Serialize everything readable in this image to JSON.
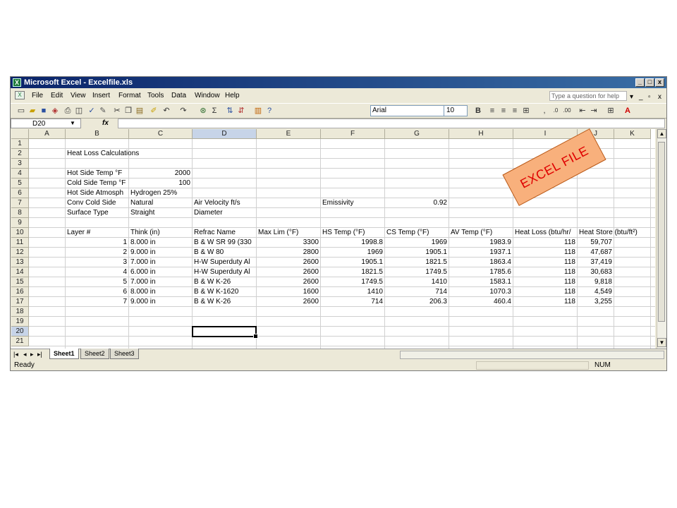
{
  "window": {
    "title": "Microsoft Excel - Excelfile.xls",
    "controls": [
      "_",
      "□",
      "x"
    ]
  },
  "menubar": {
    "items": [
      "File",
      "Edit",
      "View",
      "Insert",
      "Format",
      "Tools",
      "Data",
      "Window",
      "Help"
    ],
    "ask_placeholder": "Type a question for help",
    "doc_controls": [
      "▾",
      "_",
      "▫",
      "x"
    ]
  },
  "toolbar": {
    "font_name": "Arial",
    "font_size": "10",
    "bold_label": "B",
    "icons": [
      "new-icon",
      "open-icon",
      "save-icon",
      "permission-icon",
      "print-icon",
      "print-preview-icon",
      "spelling-icon",
      "research-icon",
      "cut-icon",
      "copy-icon",
      "paste-icon",
      "format-painter-icon",
      "undo-icon",
      "redo-icon",
      "hyperlink-icon",
      "autosum-icon",
      "sort-ascending-icon",
      "sort-descending-icon",
      "chart-wizard-icon",
      "help-icon",
      "align-left-icon",
      "center-icon",
      "align-right-icon",
      "merge-center-icon",
      "comma-style-icon",
      "increase-decimal-icon",
      "decrease-decimal-icon",
      "decrease-indent-icon",
      "increase-indent-icon",
      "borders-icon",
      "font-color-icon"
    ]
  },
  "formula_bar": {
    "name_box": "D20",
    "fx_label": "fx",
    "content": ""
  },
  "grid": {
    "columns": [
      "A",
      "B",
      "C",
      "D",
      "E",
      "F",
      "G",
      "H",
      "I",
      "J",
      "K"
    ],
    "rows": [
      "1",
      "2",
      "3",
      "4",
      "5",
      "6",
      "7",
      "8",
      "9",
      "10",
      "11",
      "12",
      "13",
      "14",
      "15",
      "16",
      "17",
      "18",
      "19",
      "20",
      "21"
    ],
    "selected_cell": "D20",
    "selected_column": "D",
    "selected_row": "20",
    "cells": {
      "B2": "Heat Loss Calculations",
      "B4": "Hot Side Temp °F",
      "C4": "2000",
      "B5": "Cold Side Temp °F",
      "C5": "100",
      "B6": "Hot Side Atmosph",
      "C6": "Hydrogen 25%",
      "B7": "Conv Cold Side",
      "C7": "Natural",
      "D7": "Air Velocity ft/s",
      "F7": "Emissivity",
      "G7": "0.92",
      "B8": "Surface Type",
      "C8": "Straight",
      "D8": "Diameter",
      "B10": "Layer #",
      "C10": "Think    (in)",
      "D10": "Refrac Name",
      "E10": "Max Lim  (°F)",
      "F10": "HS Temp  (°F)",
      "G10": "CS Temp  (°F)",
      "H10": "AV Temp  (°F)",
      "I10": "Heat Loss  (btu/hr/",
      "J10": "Heat Store   (btu/ft²)",
      "layers": [
        {
          "layer": "1",
          "think": "8.000 in",
          "name": "B & W SR 99 (330",
          "max": "3300",
          "hs": "1998.8",
          "cs": "1969",
          "av": "1983.9",
          "loss": "118",
          "store": "59,707"
        },
        {
          "layer": "2",
          "think": "9.000 in",
          "name": "B & W 80",
          "max": "2800",
          "hs": "1969",
          "cs": "1905.1",
          "av": "1937.1",
          "loss": "118",
          "store": "47,687"
        },
        {
          "layer": "3",
          "think": "7.000 in",
          "name": "H-W Superduty Al",
          "max": "2600",
          "hs": "1905.1",
          "cs": "1821.5",
          "av": "1863.4",
          "loss": "118",
          "store": "37,419"
        },
        {
          "layer": "4",
          "think": "6.000 in",
          "name": "H-W Superduty Al",
          "max": "2600",
          "hs": "1821.5",
          "cs": "1749.5",
          "av": "1785.6",
          "loss": "118",
          "store": "30,683"
        },
        {
          "layer": "5",
          "think": "7.000 in",
          "name": "B & W K-26",
          "max": "2600",
          "hs": "1749.5",
          "cs": "1410",
          "av": "1583.1",
          "loss": "118",
          "store": "9,818"
        },
        {
          "layer": "6",
          "think": "8.000 in",
          "name": "B & W K-1620",
          "max": "1600",
          "hs": "1410",
          "cs": "714",
          "av": "1070.3",
          "loss": "118",
          "store": "4,549"
        },
        {
          "layer": "7",
          "think": "9.000 in",
          "name": "B & W K-26",
          "max": "2600",
          "hs": "714",
          "cs": "206.3",
          "av": "460.4",
          "loss": "118",
          "store": "3,255"
        }
      ]
    }
  },
  "sheet_tabs": {
    "nav": [
      "|◂",
      "◂",
      "▸",
      "▸|"
    ],
    "tabs": [
      "Sheet1",
      "Sheet2",
      "Sheet3"
    ],
    "active": "Sheet1"
  },
  "statusbar": {
    "left": "Ready",
    "indicator": "NUM"
  },
  "stamp": {
    "text": "EXCEL FILE",
    "color": "#f8b07c"
  },
  "colors": {
    "titlebar": "#0a246a",
    "chrome": "#ece9d8",
    "gridline": "#d0d0d0",
    "selected_header": "#c7d4e8"
  }
}
